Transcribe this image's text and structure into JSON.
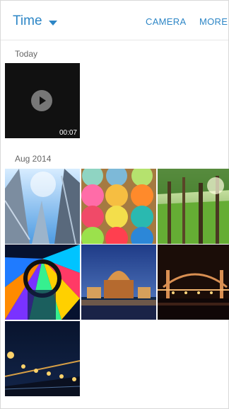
{
  "header": {
    "title": "Time",
    "actions": [
      {
        "label": "CAMERA"
      },
      {
        "label": "MORE"
      }
    ]
  },
  "sections": [
    {
      "label": "Today",
      "items": [
        {
          "type": "video",
          "duration": "00:07"
        }
      ]
    },
    {
      "label": "Aug 2014",
      "items": [
        {
          "type": "photo",
          "subject": "skyscrapers"
        },
        {
          "type": "photo",
          "subject": "yarn-balls"
        },
        {
          "type": "photo",
          "subject": "forest"
        },
        {
          "type": "photo",
          "subject": "stained-glass"
        },
        {
          "type": "photo",
          "subject": "palace-night"
        },
        {
          "type": "photo",
          "subject": "bridge-night"
        },
        {
          "type": "photo",
          "subject": "waterfront-lights"
        }
      ]
    }
  ]
}
